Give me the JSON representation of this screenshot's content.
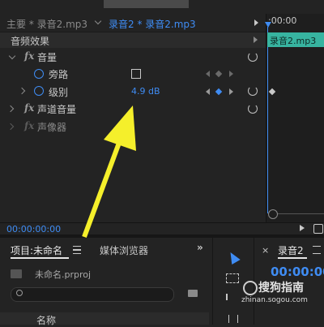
{
  "header": {
    "tab_master": "主要 * 录音2.mp3",
    "tab_active": "录音2 * 录音2.mp3",
    "timeline_time": ":00:00",
    "clip_label": "录音2.mp3"
  },
  "effects": {
    "section_title": "音频效果",
    "volume": "音量",
    "bypass": "旁路",
    "level": "级别",
    "level_value": "4.9 dB",
    "channel_volume": "声道音量",
    "panner": "声像器"
  },
  "footer": {
    "timecode": "00:00:00:00"
  },
  "project": {
    "tab_project": "项目:未命名",
    "tab_media": "媒体浏览器",
    "file_name": "未命名.prproj",
    "column_name": "名称"
  },
  "sequence": {
    "tab_name": "录音2",
    "timecode": "00:00:00"
  },
  "watermark": {
    "brand": "搜狗指南",
    "url": "zhinan.sogou.com"
  },
  "colors": {
    "accent": "#3f8cf3",
    "clip": "#37b4a0",
    "arrow": "#f5ef2b"
  }
}
